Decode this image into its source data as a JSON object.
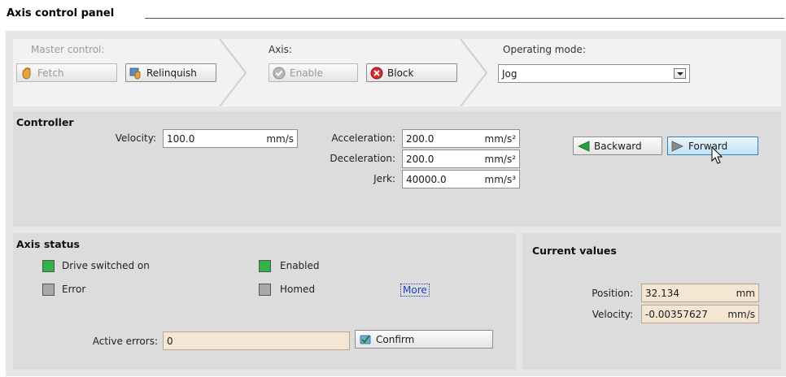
{
  "panel": {
    "title": "Axis control panel"
  },
  "master_control": {
    "label": "Master control:",
    "fetch_label": "Fetch",
    "relinquish_label": "Relinquish"
  },
  "axis": {
    "label": "Axis:",
    "enable_label": "Enable",
    "block_label": "Block"
  },
  "operating_mode": {
    "label": "Operating mode:",
    "selected": "Jog"
  },
  "controller": {
    "title": "Controller",
    "velocity": {
      "label": "Velocity:",
      "value": "100.0",
      "unit": "mm/s"
    },
    "acceleration": {
      "label": "Acceleration:",
      "value": "200.0",
      "unit": "mm/s²"
    },
    "deceleration": {
      "label": "Deceleration:",
      "value": "200.0",
      "unit": "mm/s²"
    },
    "jerk": {
      "label": "Jerk:",
      "value": "40000.0",
      "unit": "mm/s³"
    },
    "backward_label": "Backward",
    "forward_label": "Forward"
  },
  "axis_status": {
    "title": "Axis status",
    "indicators": {
      "drive_switched_on": {
        "label": "Drive switched on",
        "state": "on"
      },
      "enabled": {
        "label": "Enabled",
        "state": "on"
      },
      "error": {
        "label": "Error",
        "state": "off"
      },
      "homed": {
        "label": "Homed",
        "state": "off"
      }
    },
    "more_label": "More",
    "active_errors_label": "Active errors:",
    "active_errors_value": "0",
    "confirm_label": "Confirm"
  },
  "current_values": {
    "title": "Current values",
    "position": {
      "label": "Position:",
      "value": "32.134",
      "unit": "mm"
    },
    "velocity": {
      "label": "Velocity:",
      "value": "-0.00357627",
      "unit": "mm/s"
    }
  },
  "colors": {
    "led_on": "#2fb44a",
    "led_off": "#a9a9a9",
    "readonly_field": "#f5e6d3",
    "link": "#1b3fbf"
  },
  "icons": {
    "fetch": "hand-grab-icon",
    "relinquish": "hand-release-icon",
    "enable": "check-circle-icon",
    "block": "x-circle-icon",
    "backward": "arrow-left-icon",
    "forward": "arrow-right-icon",
    "confirm": "acknowledge-icon",
    "cursor": "mouse-pointer-icon"
  }
}
